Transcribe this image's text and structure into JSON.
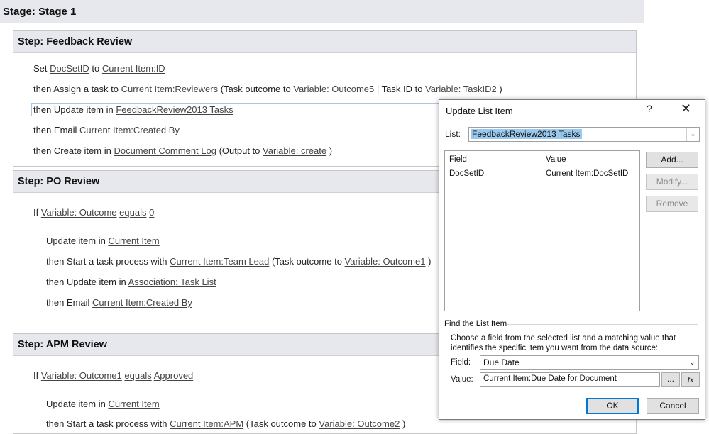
{
  "stage": {
    "title": "Stage: Stage 1"
  },
  "steps": [
    {
      "title": "Step: Feedback Review",
      "lines": [
        [
          "Set ",
          "DocSetID",
          " to ",
          "Current Item:ID"
        ],
        [
          "then Assign a task to ",
          "Current Item:Reviewers",
          " (Task outcome to ",
          "Variable: Outcome5",
          " | Task ID to ",
          "Variable: TaskID2",
          " )"
        ],
        [
          "then Update item in ",
          "FeedbackReview2013 Tasks"
        ],
        [
          "then Email ",
          "Current Item:Created By"
        ],
        [
          "then Create item in ",
          "Document Comment Log",
          " (Output to ",
          "Variable: create",
          " )"
        ]
      ]
    },
    {
      "title": "Step: PO Review",
      "condition": [
        "If ",
        "Variable: Outcome",
        " ",
        "equals",
        " ",
        "0"
      ],
      "lines": [
        [
          "Update item in ",
          "Current Item"
        ],
        [
          "then Start a task process with ",
          "Current Item:Team Lead",
          " (Task outcome to ",
          "Variable: Outcome1",
          " )"
        ],
        [
          "then Update item in ",
          "Association: Task List"
        ],
        [
          "then Email ",
          "Current Item:Created By"
        ]
      ]
    },
    {
      "title": "Step: APM Review",
      "condition": [
        "If ",
        "Variable: Outcome1",
        " ",
        "equals",
        " ",
        "Approved"
      ],
      "lines": [
        [
          "Update item in ",
          "Current Item"
        ],
        [
          "then Start a task process with ",
          "Current Item:APM",
          " (Task outcome to ",
          "Variable: Outcome2",
          " )"
        ]
      ]
    }
  ],
  "dialog": {
    "title": "Update List Item",
    "help": "?",
    "close": "✕",
    "list_label": "List:",
    "list_value": "FeedbackReview2013 Tasks",
    "columns": [
      "Field",
      "Value"
    ],
    "rows": [
      [
        "DocSetID",
        "Current Item:DocSetID"
      ]
    ],
    "buttons": {
      "add": "Add...",
      "modify": "Modify...",
      "remove": "Remove",
      "ok": "OK",
      "cancel": "Cancel"
    },
    "find": {
      "heading": "Find the List Item",
      "desc1": "Choose a field from the selected list and a matching value that",
      "desc2": "identifies the specific item you want from the data source:",
      "field_label": "Field:",
      "field_value": "Due Date",
      "value_label": "Value:",
      "value_value": "Current Item:Due Date for Document",
      "ellipsis": "...",
      "fx": "fx"
    }
  }
}
